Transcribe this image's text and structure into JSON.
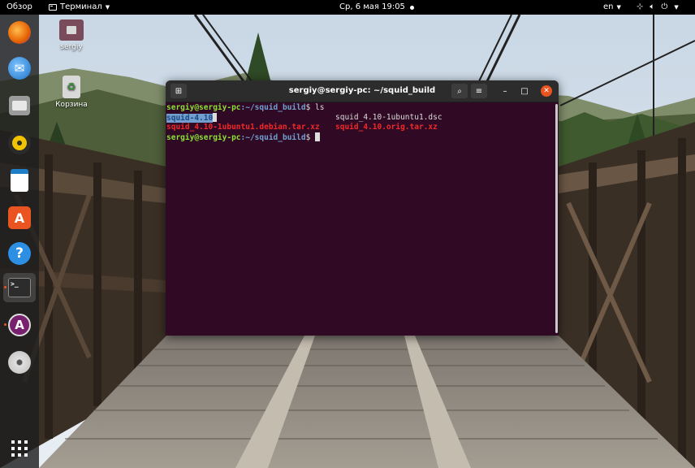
{
  "topbar": {
    "activities": "Обзор",
    "app_name": "Терминал",
    "clock": "Ср, 6 мая  19:05",
    "language": "en"
  },
  "dock": {
    "items": [
      {
        "name": "firefox",
        "icon": "firefox-icon"
      },
      {
        "name": "thunderbird",
        "icon": "thunderbird-icon"
      },
      {
        "name": "files",
        "icon": "files-icon"
      },
      {
        "name": "rhythmbox",
        "icon": "rhythmbox-icon"
      },
      {
        "name": "libreoffice-writer",
        "icon": "writer-icon"
      },
      {
        "name": "software",
        "icon": "software-center-icon"
      },
      {
        "name": "help",
        "icon": "help-icon"
      },
      {
        "name": "terminal",
        "icon": "terminal-icon"
      },
      {
        "name": "software-updater",
        "icon": "updater-icon"
      },
      {
        "name": "dvd",
        "icon": "disc-icon"
      },
      {
        "name": "show-apps",
        "icon": "grid-icon"
      }
    ]
  },
  "desktop": {
    "home_label": "sergiy",
    "trash_label": "Корзина"
  },
  "terminal": {
    "title": "sergiy@sergiy-pc: ~/squid_build",
    "prompt_user": "sergiy@sergiy-pc",
    "prompt_path": ":~/squid_build",
    "prompt_symbol": "$",
    "command": " ls",
    "dir_entry": "squid-4.10",
    "file_dsc": "squid_4.10-1ubuntu1.dsc",
    "file_debian": "squid_4.10-1ubuntu1.debian.tar.xz",
    "file_orig": "squid_4.10.orig.tar.xz"
  },
  "colors": {
    "terminal_bg": "#300a24",
    "prompt_user": "#8ae234",
    "prompt_path": "#729fcf",
    "archive": "#ef2929",
    "close_button": "#e95420"
  }
}
